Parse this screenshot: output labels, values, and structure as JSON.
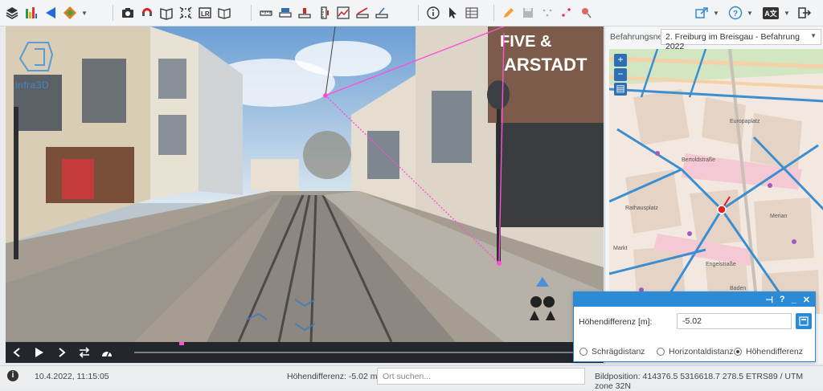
{
  "toolbar": {
    "left_icons": [
      "layers-icon",
      "terrain-icon",
      "navigate-icon",
      "plugin-icon"
    ],
    "tools": [
      "camera-icon",
      "magnet-icon",
      "measure-book-icon",
      "crop-icon",
      "lr-icon",
      "book-icon"
    ],
    "measure_tools": [
      "ruler-horizontal-icon",
      "ruler-area-icon",
      "height-icon",
      "ruler-vertical-icon",
      "profile-icon",
      "slope-icon",
      "angle-icon"
    ],
    "info_tools": [
      "info-icon",
      "pointer-icon",
      "table-icon"
    ],
    "edit_tools": [
      "pencil-icon",
      "save-icon",
      "points-icon",
      "nodes-icon",
      "pin-icon"
    ],
    "right_tools": [
      "share-icon",
      "help-icon",
      "language-icon",
      "logout-icon"
    ],
    "lang_label": "A文"
  },
  "viewer": {
    "logo_text": "infra3D",
    "sign_left": "FIVE &",
    "sign_right": "ARSTADT"
  },
  "panel": {
    "network_label": "Befahrungsnetz:",
    "network_value": "2. Freiburg im Breisgau - Befahrung 2022",
    "map_labels": [
      "Europaplatz",
      "Bertoldstraße",
      "Engelstraße",
      "Rathausplatz",
      "Merian",
      "Baden",
      "Markt"
    ]
  },
  "dialog": {
    "label": "Höhendifferenz [m]:",
    "value": "-5.02",
    "radio_slope": "Schrägdistanz",
    "radio_horizontal": "Horizontaldistanz",
    "radio_height": "Höhendifferenz",
    "selected": "Höhendifferenz"
  },
  "status": {
    "datetime": "10.4.2022, 11:15:05",
    "height_diff": "Höhendifferenz: -5.02 m",
    "search_placeholder": "Ort suchen...",
    "position": "Bildposition: 414376.5 5316618.7 278.5 ETRS89 / UTM zone 32N"
  },
  "colors": {
    "accent": "#2c8bd6",
    "measure_line": "#ff4fd8"
  }
}
